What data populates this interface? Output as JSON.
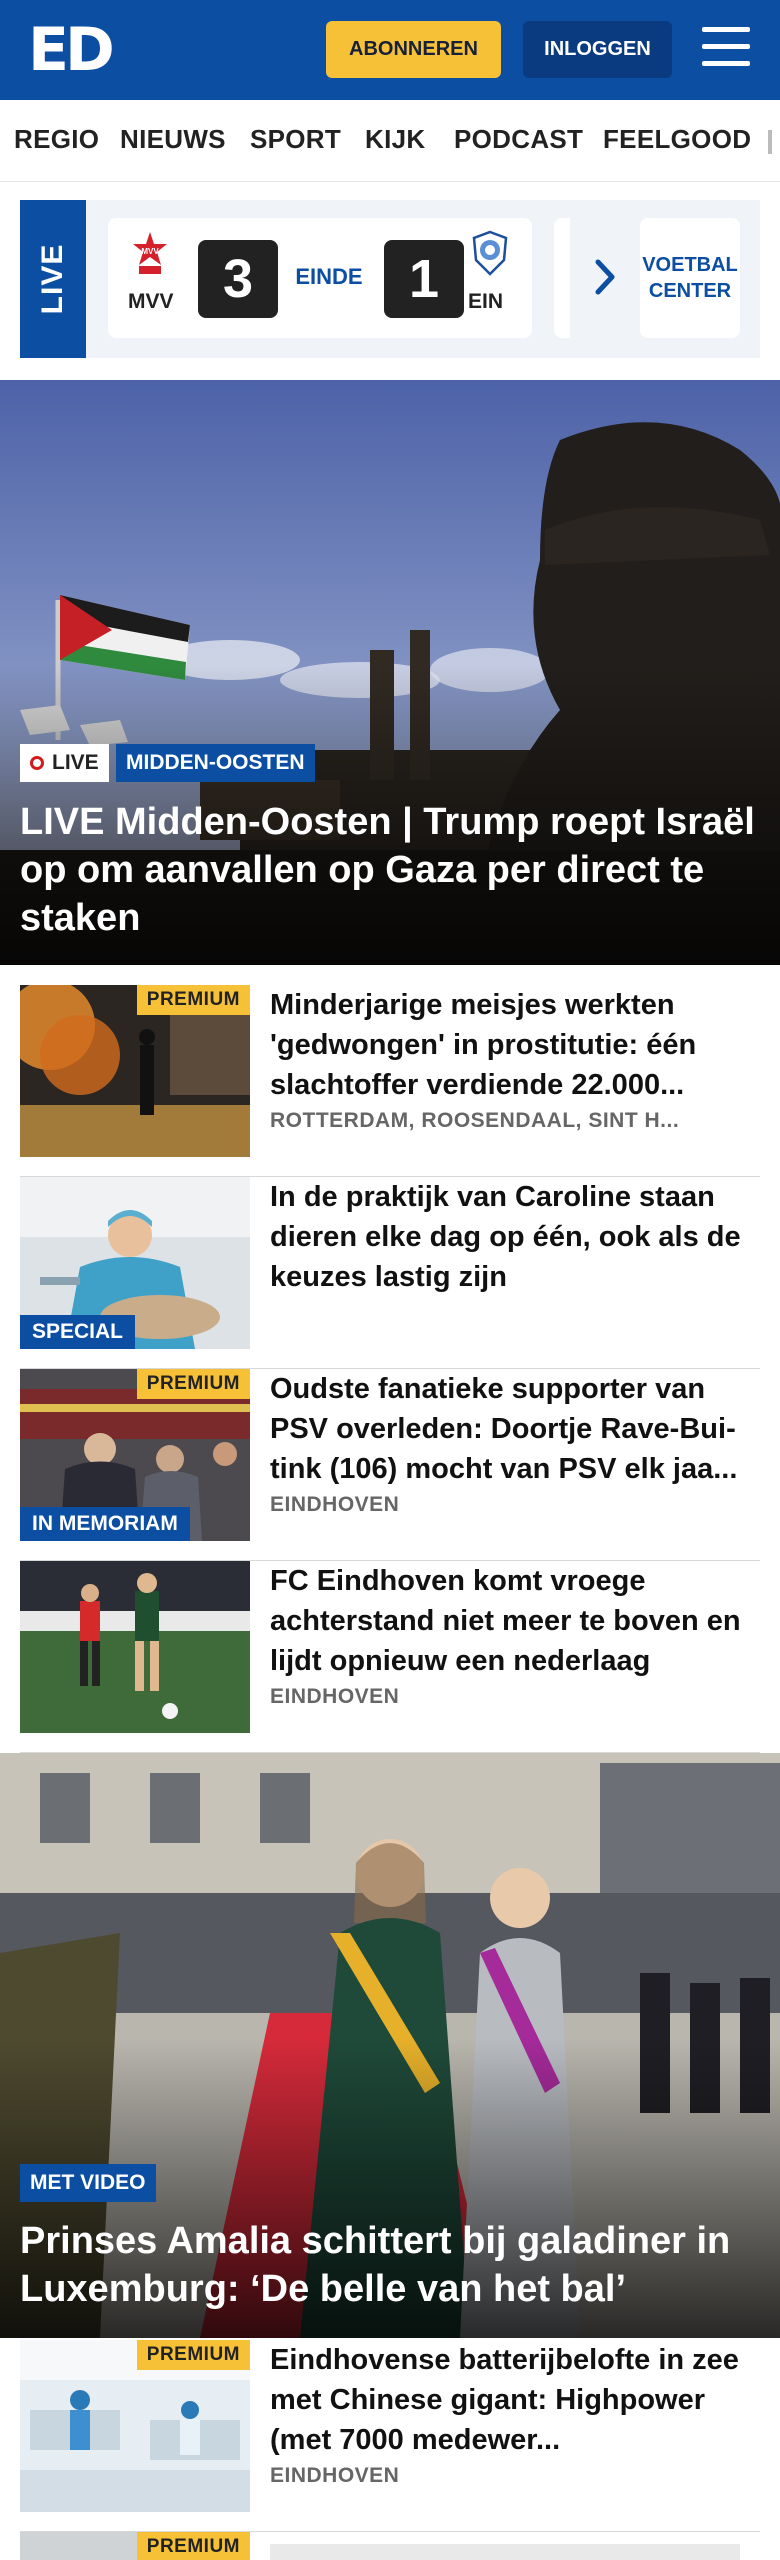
{
  "header": {
    "logo": "ED",
    "subscribe_label": "ABONNEREN",
    "login_label": "INLOGGEN"
  },
  "nav": {
    "items": [
      "REGIO",
      "NIEUWS",
      "SPORT",
      "KIJK",
      "PODCAST",
      "FEELGOOD"
    ]
  },
  "live_bar": {
    "tab_label": "LIVE",
    "match": {
      "home_team": "MVV",
      "home_logo_text": "MVV",
      "home_score": "3",
      "status": "EINDE",
      "away_score": "1",
      "away_team": "EIN"
    },
    "center_label_1": "VOETBAL",
    "center_label_2": "CENTER"
  },
  "hero1": {
    "live_badge": "LIVE",
    "category": "MIDDEN-OOSTEN",
    "title": "LIVE Midden-Oosten | Trump roept Israël op om aanvallen op Gaza per direct te staken"
  },
  "articles": [
    {
      "premium": "PREMIUM",
      "title": "Minderjarige meisjes werkten 'gedwongen' in prostitutie: één slachtoffer verdiende 22.000...",
      "location": "ROTTERDAM, ROOSENDAAL, SINT H..."
    },
    {
      "label": "SPECIAL",
      "title": "In de praktijk van Caroline staan dieren elke dag op één, ook als de keuzes lastig zijn"
    },
    {
      "premium": "PREMIUM",
      "label": "IN MEMORIAM",
      "title": "Oudste fanatieke supporter van PSV overleden: Doortje Rave-Bui­tink (106) mocht van PSV elk jaa...",
      "location": "EINDHOVEN"
    },
    {
      "title": "FC Eindhoven komt vroege achterstand niet meer te boven en lijdt opnieuw een nederlaag",
      "location": "EINDHOVEN"
    }
  ],
  "hero2": {
    "category": "MET VIDEO",
    "title": "Prinses Amalia schittert bij galadiner in Luxemburg: ‘De belle van het bal’"
  },
  "article5": {
    "premium": "PREMIUM",
    "title": "Eindhovense batterijbelofte in zee met Chinese gigant: Highpower (met 7000 medewer...",
    "location": "EINDHOVEN"
  },
  "article6": {
    "premium": "PREMIUM"
  },
  "colors": {
    "brand_blue": "#0b4ea2",
    "premium_yellow": "#f6c137",
    "dark_blue": "#0a3a80"
  }
}
